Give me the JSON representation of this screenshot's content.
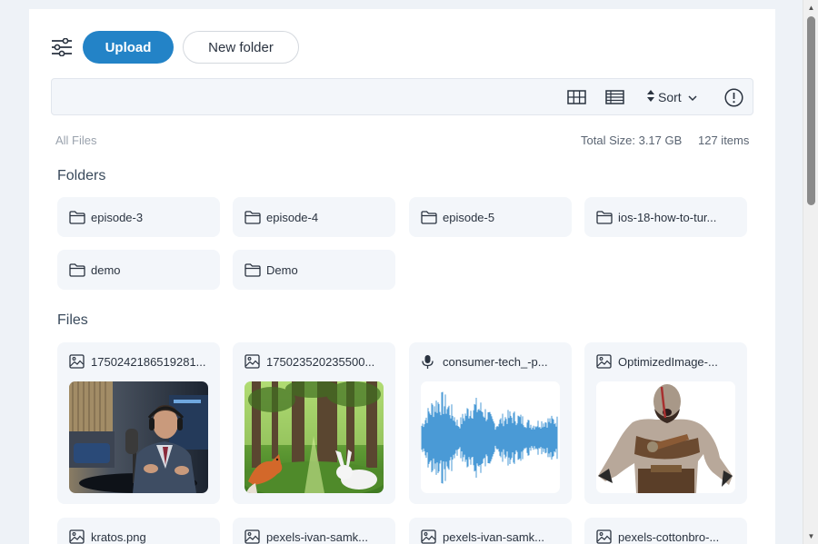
{
  "toolbar": {
    "filter_icon": "sliders-icon",
    "upload_label": "Upload",
    "new_folder_label": "New folder"
  },
  "searchbar": {
    "grid_view_icon": "grid-view-icon",
    "list_view_icon": "list-view-icon",
    "sort_label": "Sort",
    "info_icon": "info-icon"
  },
  "meta": {
    "breadcrumb": "All Files",
    "total_size": "Total Size: 3.17 GB",
    "item_count": "127 items"
  },
  "folders_title": "Folders",
  "folders": [
    {
      "name": "episode-3"
    },
    {
      "name": "episode-4"
    },
    {
      "name": "episode-5"
    },
    {
      "name": "ios-18-how-to-tur..."
    },
    {
      "name": "demo"
    },
    {
      "name": "Demo"
    }
  ],
  "files_title": "Files",
  "files": [
    {
      "name": "1750242186519281...",
      "icon": "image-icon",
      "thumb": "podcast-host-photo"
    },
    {
      "name": "175023520235500...",
      "icon": "image-icon",
      "thumb": "forest-fox-rabbit-photo"
    },
    {
      "name": "consumer-tech_-p...",
      "icon": "microphone-icon",
      "thumb": "audio-waveform"
    },
    {
      "name": "OptimizedImage-...",
      "icon": "image-icon",
      "thumb": "kratos-figure"
    },
    {
      "name": "kratos.png",
      "icon": "image-icon"
    },
    {
      "name": "pexels-ivan-samk...",
      "icon": "image-icon"
    },
    {
      "name": "pexels-ivan-samk...",
      "icon": "image-icon"
    },
    {
      "name": "pexels-cottonbro-...",
      "icon": "image-icon"
    }
  ],
  "colors": {
    "accent": "#2383c7",
    "card_bg": "#f3f6fa",
    "waveform": "#4a9ad6"
  }
}
